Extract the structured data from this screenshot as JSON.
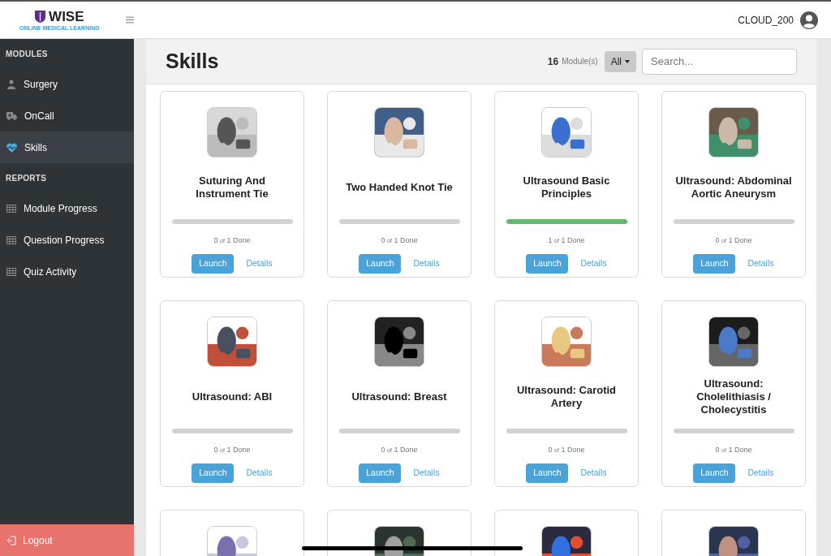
{
  "header": {
    "logo_title": "WISE",
    "logo_subtitle": "ONLINE MEDICAL LEARNING",
    "user": "CLOUD_200"
  },
  "sidebar": {
    "sections": [
      {
        "heading": "MODULES",
        "items": [
          {
            "label": "Surgery",
            "selected": false
          },
          {
            "label": "OnCall",
            "selected": false
          },
          {
            "label": "Skills",
            "selected": true
          }
        ]
      },
      {
        "heading": "REPORTS",
        "items": [
          {
            "label": "Module Progress",
            "selected": false
          },
          {
            "label": "Question Progress",
            "selected": false
          },
          {
            "label": "Quiz Activity",
            "selected": false
          }
        ]
      }
    ],
    "logout": "Logout"
  },
  "page": {
    "title": "Skills",
    "count": "16",
    "count_label": "Module(s)",
    "filter": "All",
    "search_placeholder": "Search..."
  },
  "cards": [
    {
      "kind": "module",
      "title": "Suturing And Instrument Tie",
      "level": 0,
      "done": "0",
      "of": "of",
      "total": "1 Done",
      "launch": "Launch",
      "details": "Details"
    },
    {
      "kind": "module",
      "title": "Two Handed Knot Tie",
      "level": 0,
      "done": "0",
      "of": "of",
      "total": "1 Done",
      "launch": "Launch",
      "details": "Details"
    },
    {
      "kind": "module",
      "title": "Ultrasound Basic Principles",
      "level": 1,
      "done": "1",
      "of": "of",
      "total": "1 Done",
      "launch": "Launch",
      "details": "Details"
    },
    {
      "kind": "module",
      "title": "Ultrasound: Abdominal Aortic Aneurysm",
      "level": 0,
      "done": "0",
      "of": "of",
      "total": "1 Done",
      "launch": "Launch",
      "details": "Details"
    },
    {
      "kind": "module",
      "title": "Ultrasound: ABI",
      "level": 0,
      "done": "0",
      "of": "of",
      "total": "1 Done",
      "launch": "Launch",
      "details": "Details"
    },
    {
      "kind": "module",
      "title": "Ultrasound: Breast",
      "level": 0,
      "done": "0",
      "of": "of",
      "total": "1 Done",
      "launch": "Launch",
      "details": "Details"
    },
    {
      "kind": "module",
      "title": "Ultrasound: Carotid Artery",
      "level": 0,
      "done": "0",
      "of": "of",
      "total": "1 Done",
      "launch": "Launch",
      "details": "Details"
    },
    {
      "kind": "module",
      "title": "Ultrasound: Cholelithiasis / Cholecystitis",
      "level": 0,
      "done": "0",
      "of": "of",
      "total": "1 Done",
      "launch": "Launch",
      "details": "Details"
    },
    {
      "kind": "partial"
    },
    {
      "kind": "partial"
    },
    {
      "kind": "partial"
    },
    {
      "kind": "partial"
    }
  ]
}
